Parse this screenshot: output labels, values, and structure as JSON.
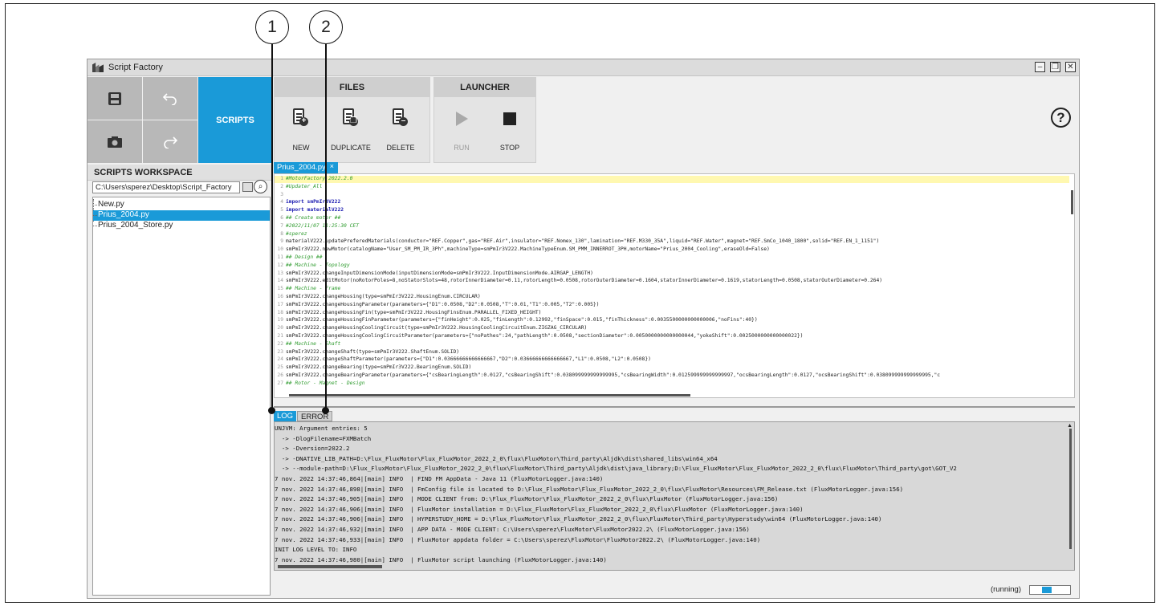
{
  "callouts": [
    "1",
    "2"
  ],
  "window": {
    "title": "Script Factory",
    "controls": [
      "minimize-icon",
      "restore-icon",
      "close-icon"
    ]
  },
  "toolbar": {
    "scripts_label": "SCRIPTS"
  },
  "ribbon": {
    "files_label": "FILES",
    "launcher_label": "LAUNCHER",
    "new_label": "NEW",
    "duplicate_label": "DUPLICATE",
    "delete_label": "DELETE",
    "run_label": "RUN",
    "stop_label": "STOP",
    "help_label": "?"
  },
  "workspace": {
    "title": "SCRIPTS WORKSPACE",
    "path": "C:\\Users\\sperez\\Desktop\\Script_Factory",
    "files": [
      "New.py",
      "Prius_2004.py",
      "Prius_2004_Store.py"
    ],
    "selected_file": "Prius_2004.py"
  },
  "editor": {
    "tab_label": "Prius_2004.py",
    "tab_close": "×",
    "lines": [
      {
        "n": "1",
        "t": "#MotorFactory 2022.2.0",
        "k": "cm"
      },
      {
        "n": "2",
        "t": "#Updater_All",
        "k": "cm"
      },
      {
        "n": "3",
        "t": "",
        "k": ""
      },
      {
        "n": "4",
        "t": "import smPmIr3V222",
        "k": "kw"
      },
      {
        "n": "5",
        "t": "import materialV222",
        "k": "kw"
      },
      {
        "n": "6",
        "t": "## Create motor ##",
        "k": "cm"
      },
      {
        "n": "7",
        "t": "#2022/11/07 11:25:30 CET",
        "k": "cm"
      },
      {
        "n": "8",
        "t": "#sperez",
        "k": "cm"
      },
      {
        "n": "9",
        "t": "materialV222.updatePreferedMaterials(conductor=\"REF.Copper\",gas=\"REF.Air\",insulator=\"REF.Nomex_130\",lamination=\"REF.M330_35A\",liquid=\"REF.Water\",magnet=\"REF.SmCo_1040_1800\",solid=\"REF.EN_1_1151\")",
        "k": ""
      },
      {
        "n": "10",
        "t": "smPmIr3V222.newMotor(catalogName=\"User_SM_PM_IR_3Ph\",machineType=smPmIr3V222.MachineTypeEnum.SM_PMM_INNERROT_3PH,motorName=\"Prius_2004_Cooling\",eraseOld=False)",
        "k": ""
      },
      {
        "n": "11",
        "t": "## Design ##",
        "k": "cm"
      },
      {
        "n": "12",
        "t": "## Machine - Topology",
        "k": "cm"
      },
      {
        "n": "13",
        "t": "smPmIr3V222.changeInputDimensionMode(inputDimensionMode=smPmIr3V222.InputDimensionMode.AIRGAP_LENGTH)",
        "k": ""
      },
      {
        "n": "14",
        "t": "smPmIr3V222.editMotor(noRotorPoles=8,noStatorSlots=48,rotorInnerDiameter=0.11,rotorLength=0.0508,rotorOuterDiameter=0.1604,statorInnerDiameter=0.1619,statorLength=0.0508,statorOuterDiameter=0.264)",
        "k": ""
      },
      {
        "n": "15",
        "t": "## Machine - Frame",
        "k": "cm"
      },
      {
        "n": "16",
        "t": "smPmIr3V222.changeHousing(type=smPmIr3V222.HousingEnum.CIRCULAR)",
        "k": ""
      },
      {
        "n": "17",
        "t": "smPmIr3V222.changeHousingParameter(parameters={\"D1\":0.0508,\"D2\":0.0508,\"T\":0.01,\"T1\":0.005,\"T2\":0.005})",
        "k": ""
      },
      {
        "n": "18",
        "t": "smPmIr3V222.changeHousingFin(type=smPmIr3V222.HousingFinsEnum.PARALLEL_FIXED_HEIGHT)",
        "k": ""
      },
      {
        "n": "19",
        "t": "smPmIr3V222.changeHousingFinParameter(parameters={\"finHeight\":0.025,\"finLength\":0.12992,\"finSpace\":0.015,\"finThickness\":0.0035500000000000006,\"noFins\":40})",
        "k": ""
      },
      {
        "n": "20",
        "t": "smPmIr3V222.changeHousingCoolingCircuit(type=smPmIr3V222.HousingCoolingCircuitEnum.ZIGZAG_CIRCULAR)",
        "k": ""
      },
      {
        "n": "21",
        "t": "smPmIr3V222.changeHousingCoolingCircuitParameter(parameters={\"noPathes\":24,\"pathLength\":0.0508,\"sectionDiameter\":0.0050000000000000044,\"yokeShift\":0.0025000000000000022})",
        "k": ""
      },
      {
        "n": "22",
        "t": "## Machine - Shaft",
        "k": "cm"
      },
      {
        "n": "23",
        "t": "smPmIr3V222.changeShaft(type=smPmIr3V222.ShaftEnum.SOLID)",
        "k": ""
      },
      {
        "n": "24",
        "t": "smPmIr3V222.changeShaftParameter(parameters={\"D1\":0.03666666666666667,\"D2\":0.03666666666666667,\"L1\":0.0508,\"L2\":0.0508})",
        "k": ""
      },
      {
        "n": "25",
        "t": "smPmIr3V222.changeBearing(type=smPmIr3V222.BearingEnum.SOLID)",
        "k": ""
      },
      {
        "n": "26",
        "t": "smPmIr3V222.changeBearingParameter(parameters={\"csBearingLength\":0.0127,\"csBearingShift\":0.038099999999999995,\"csBearingWidth\":0.012599999999999997,\"ocsBearingLength\":0.0127,\"ocsBearingShift\":0.038099999999999995,\"c",
        "k": ""
      },
      {
        "n": "27",
        "t": "## Rotor - Magnet - Design",
        "k": "cm"
      }
    ]
  },
  "log": {
    "tab_log": "LOG",
    "tab_error": "ERROR",
    "lines": [
      "UNJVM: Argument entries: 5",
      "  -> -DlogFilename=FXMBatch",
      "  -> -Dversion=2022.2",
      "  -> -DNATIVE_LIB_PATH=D:\\Flux_FluxMotor\\Flux_FluxMotor_2022_2_0\\flux\\FluxMotor\\Third_party\\Aljdk\\dist\\shared_libs\\win64_x64",
      "  -> --module-path=D:\\Flux_FluxMotor\\Flux_FluxMotor_2022_2_0\\flux\\FluxMotor\\Third_party\\Aljdk\\dist\\java_library;D:\\Flux_FluxMotor\\Flux_FluxMotor_2022_2_0\\flux\\FluxMotor\\Third_party\\got\\GOT_V2",
      "7 nov. 2022 14:37:46,864|[main] INFO  | FIND FM AppData - Java 11 (FluxMotorLogger.java:140)",
      "7 nov. 2022 14:37:46,898|[main] INFO  | FmConfig file is located to D:\\Flux_FluxMotor\\Flux_FluxMotor_2022_2_0\\flux\\FluxMotor\\Resources\\FM_Release.txt (FluxMotorLogger.java:156)",
      "7 nov. 2022 14:37:46,905|[main] INFO  | MODE CLIENT from: D:\\Flux_FluxMotor\\Flux_FluxMotor_2022_2_0\\flux\\FluxMotor (FluxMotorLogger.java:156)",
      "7 nov. 2022 14:37:46,906|[main] INFO  | FluxMotor installation = D:\\Flux_FluxMotor\\Flux_FluxMotor_2022_2_0\\flux\\FluxMotor (FluxMotorLogger.java:140)",
      "7 nov. 2022 14:37:46,906|[main] INFO  | HYPERSTUDY_HOME = D:\\Flux_FluxMotor\\Flux_FluxMotor_2022_2_0\\flux\\FluxMotor\\Third_party\\Hyperstudy\\win64 (FluxMotorLogger.java:140)",
      "7 nov. 2022 14:37:46,932|[main] INFO  | APP DATA - MODE CLIENT: C:\\Users\\sperez\\FluxMotor\\FluxMotor2022.2\\ (FluxMotorLogger.java:156)",
      "7 nov. 2022 14:37:46,933|[main] INFO  | FluxMotor appdata folder = C:\\Users\\sperez\\FluxMotor\\FluxMotor2022.2\\ (FluxMotorLogger.java:140)",
      "INIT LOG LEVEL TO: INFO",
      "7 nov. 2022 14:37:46,980|[main] INFO  | FluxMotor script launching (FluxMotorLogger.java:140)"
    ]
  },
  "status": {
    "text": "(running)",
    "progress_fraction": 0.4
  },
  "colors": {
    "accent": "#1a9ad8",
    "editor_highlight": "#fff8b0",
    "comment": "#2e9b2e"
  }
}
